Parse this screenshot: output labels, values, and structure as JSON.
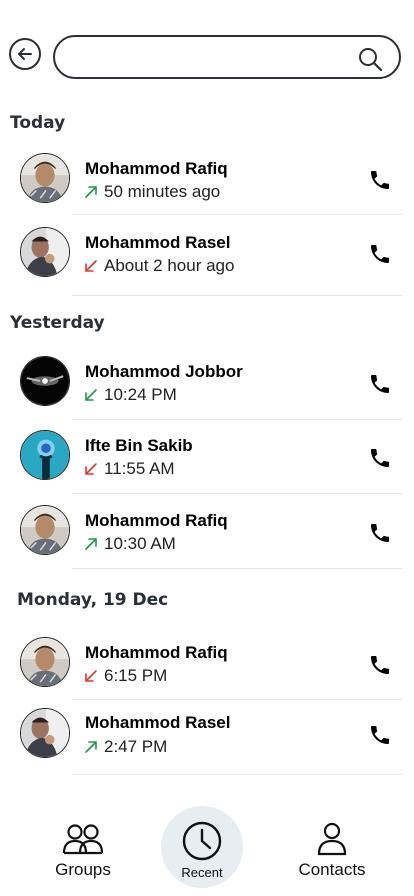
{
  "search": {
    "placeholder": ""
  },
  "sections": [
    {
      "title": "Today"
    },
    {
      "title": "Yesterday"
    },
    {
      "title": "Monday, 19 Dec"
    }
  ],
  "calls": [
    {
      "name": "Mohammod Rafiq",
      "time": "50 minutes ago",
      "direction": "outgoing",
      "avatar": "avatar-rafiq"
    },
    {
      "name": "Mohammod Rasel",
      "time": "About 2 hour ago",
      "direction": "missed",
      "avatar": "avatar-rasel"
    },
    {
      "name": "Mohammod Jobbor",
      "time": "10:24 PM",
      "direction": "incoming",
      "avatar": "avatar-jobbor"
    },
    {
      "name": "Ifte Bin Sakib",
      "time": "11:55 AM",
      "direction": "missed",
      "avatar": "avatar-sakib"
    },
    {
      "name": "Mohammod Rafiq",
      "time": "10:30 AM",
      "direction": "outgoing",
      "avatar": "avatar-rafiq"
    },
    {
      "name": "Mohammod Rafiq",
      "time": "6:15 PM",
      "direction": "missed",
      "avatar": "avatar-rafiq"
    },
    {
      "name": "Mohammod Rasel",
      "time": "2:47 PM",
      "direction": "outgoing",
      "avatar": "avatar-rasel"
    }
  ],
  "nav": {
    "groups_label": "Groups",
    "recent_label": "Recent",
    "contacts_label": "Contacts"
  },
  "colors": {
    "outgoing": "#1a9a4a",
    "missed": "#e0392b",
    "incoming": "#1a9a4a",
    "recent_bg": "#e6eef1"
  }
}
